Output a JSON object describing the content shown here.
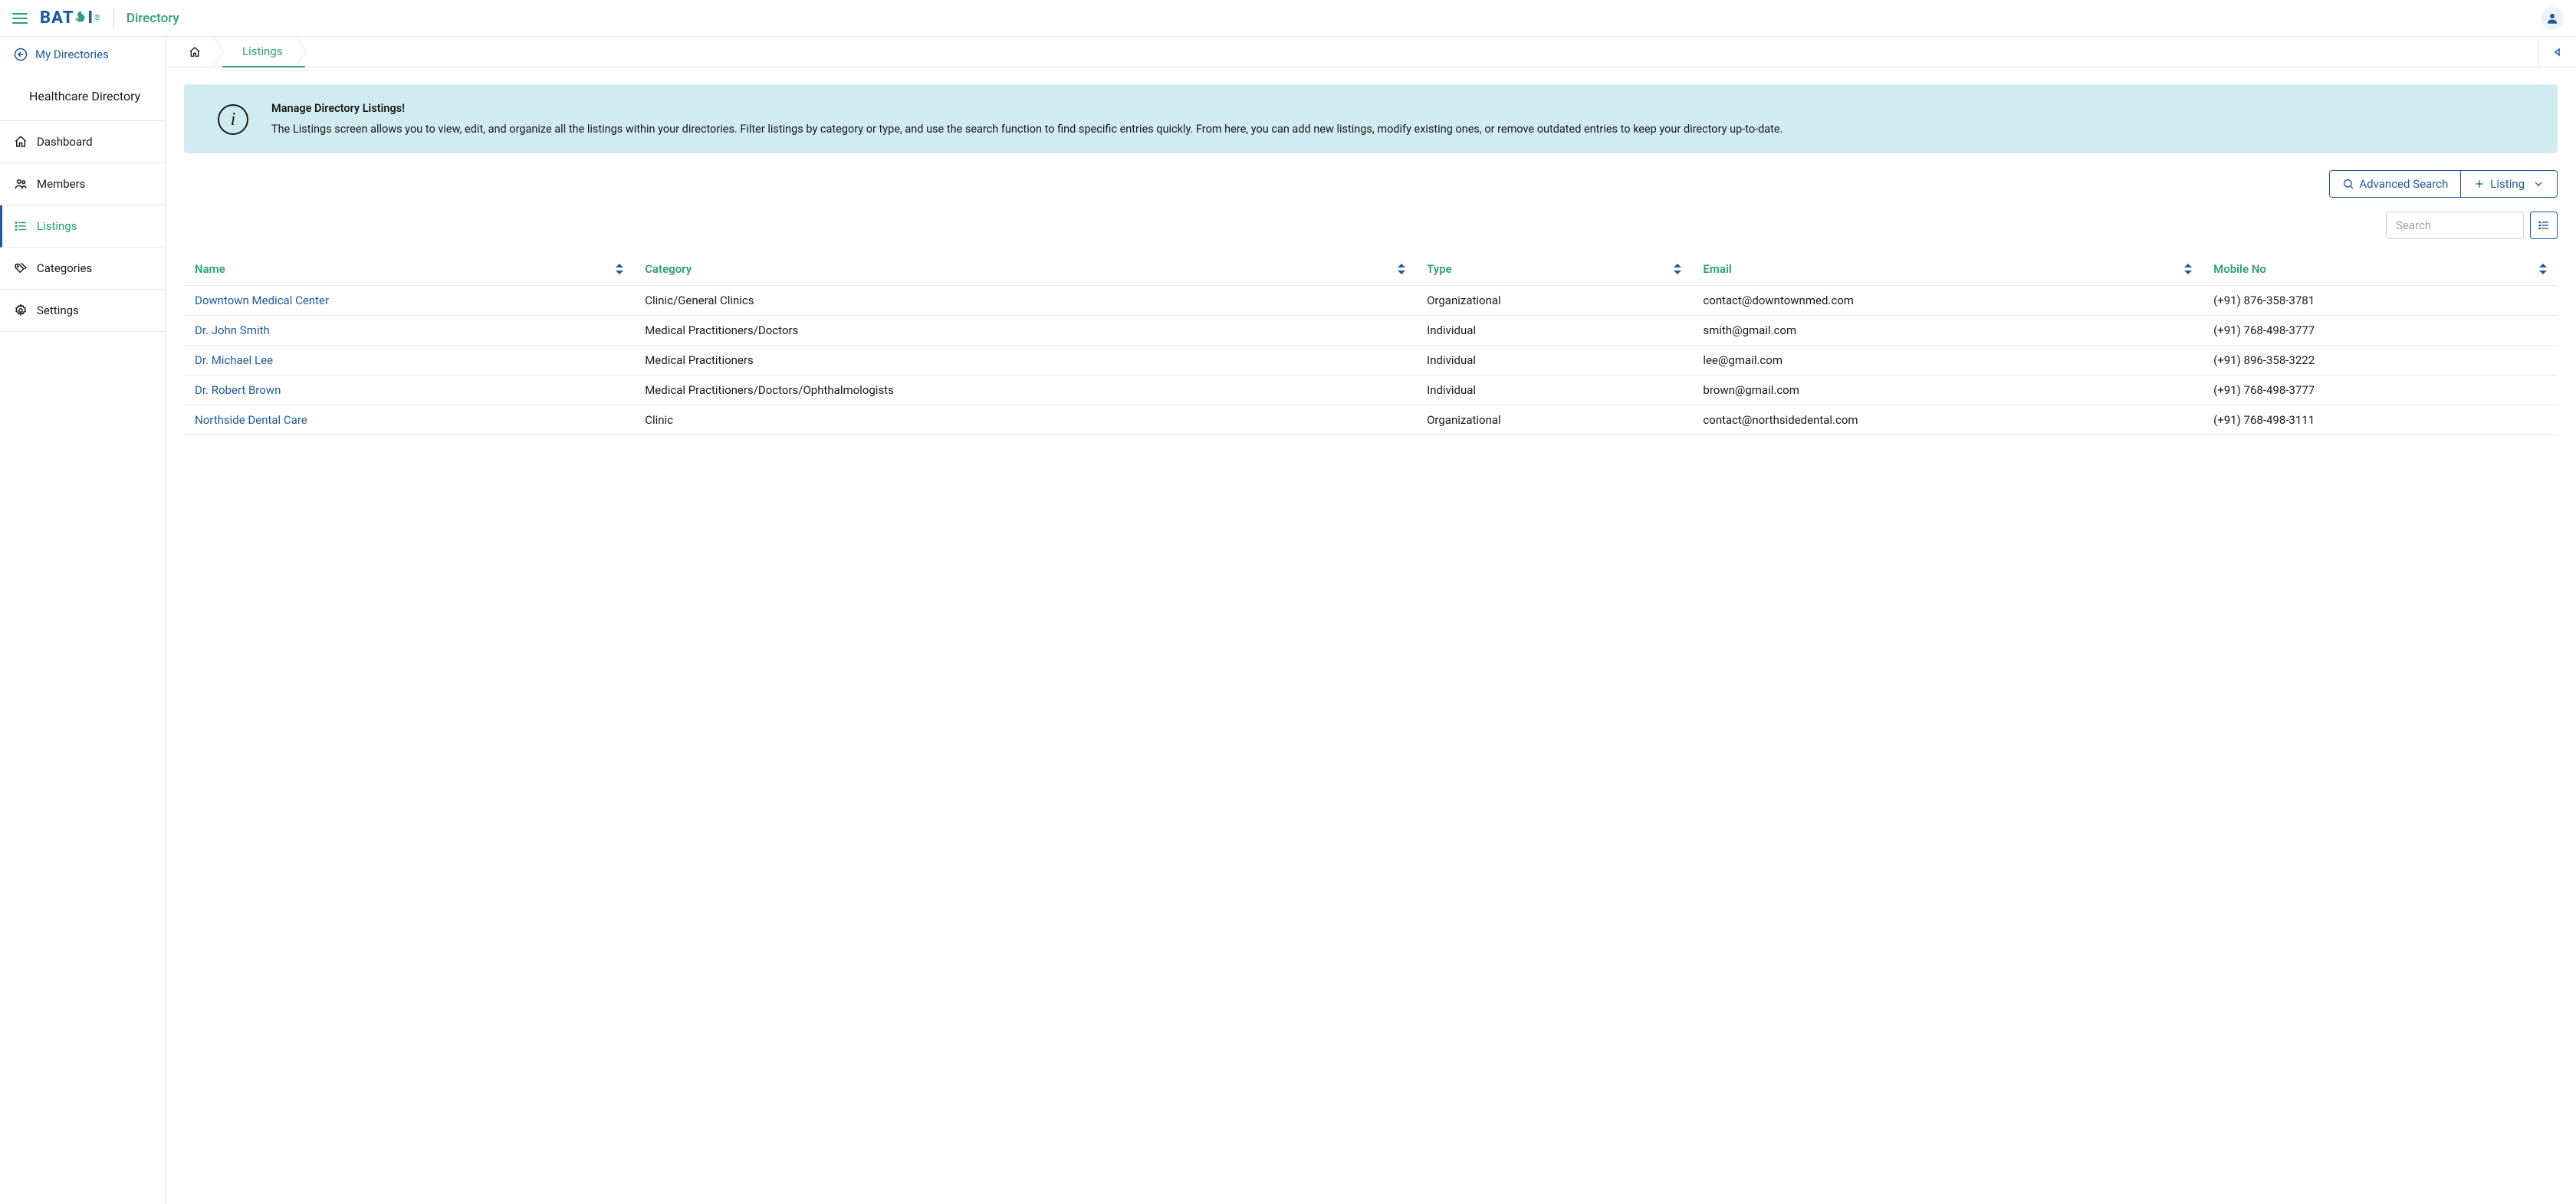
{
  "header": {
    "logo_text": "BAT",
    "logo_suffix": "I",
    "logo_reg": "®",
    "app_title": "Directory"
  },
  "sidebar": {
    "back_label": "My Directories",
    "directory_name": "Healthcare Directory",
    "items": [
      {
        "label": "Dashboard",
        "icon": "home",
        "active": false
      },
      {
        "label": "Members",
        "icon": "members",
        "active": false
      },
      {
        "label": "Listings",
        "icon": "list",
        "active": true
      },
      {
        "label": "Categories",
        "icon": "tags",
        "active": false
      },
      {
        "label": "Settings",
        "icon": "gear",
        "active": false
      }
    ]
  },
  "breadcrumb": {
    "current": "Listings"
  },
  "info_banner": {
    "title": "Manage Directory Listings!",
    "body": "The Listings screen allows you to view, edit, and organize all the listings within your directories. Filter listings by category or type, and use the search function to find specific entries quickly. From here, you can add new listings, modify existing ones, or remove outdated entries to keep your directory up-to-date."
  },
  "toolbar": {
    "advanced_search": "Advanced Search",
    "add_listing": "Listing"
  },
  "search": {
    "placeholder": "Search"
  },
  "table": {
    "columns": [
      {
        "label": "Name"
      },
      {
        "label": "Category"
      },
      {
        "label": "Type"
      },
      {
        "label": "Email"
      },
      {
        "label": "Mobile No"
      }
    ],
    "rows": [
      {
        "name": "Downtown Medical Center",
        "category": "Clinic/General Clinics",
        "type": "Organizational",
        "email": "contact@downtownmed.com",
        "mobile": "(+91) 876-358-3781"
      },
      {
        "name": "Dr. John Smith",
        "category": "Medical Practitioners/Doctors",
        "type": "Individual",
        "email": "smith@gmail.com",
        "mobile": "(+91) 768-498-3777"
      },
      {
        "name": "Dr. Michael Lee",
        "category": "Medical Practitioners",
        "type": "Individual",
        "email": "lee@gmail.com",
        "mobile": "(+91) 896-358-3222"
      },
      {
        "name": "Dr. Robert Brown",
        "category": "Medical Practitioners/Doctors/Ophthalmologists",
        "type": "Individual",
        "email": "brown@gmail.com",
        "mobile": "(+91) 768-498-3777"
      },
      {
        "name": "Northside Dental Care",
        "category": "Clinic",
        "type": "Organizational",
        "email": "contact@northsidedental.com",
        "mobile": "(+91) 768-498-3111"
      }
    ]
  }
}
